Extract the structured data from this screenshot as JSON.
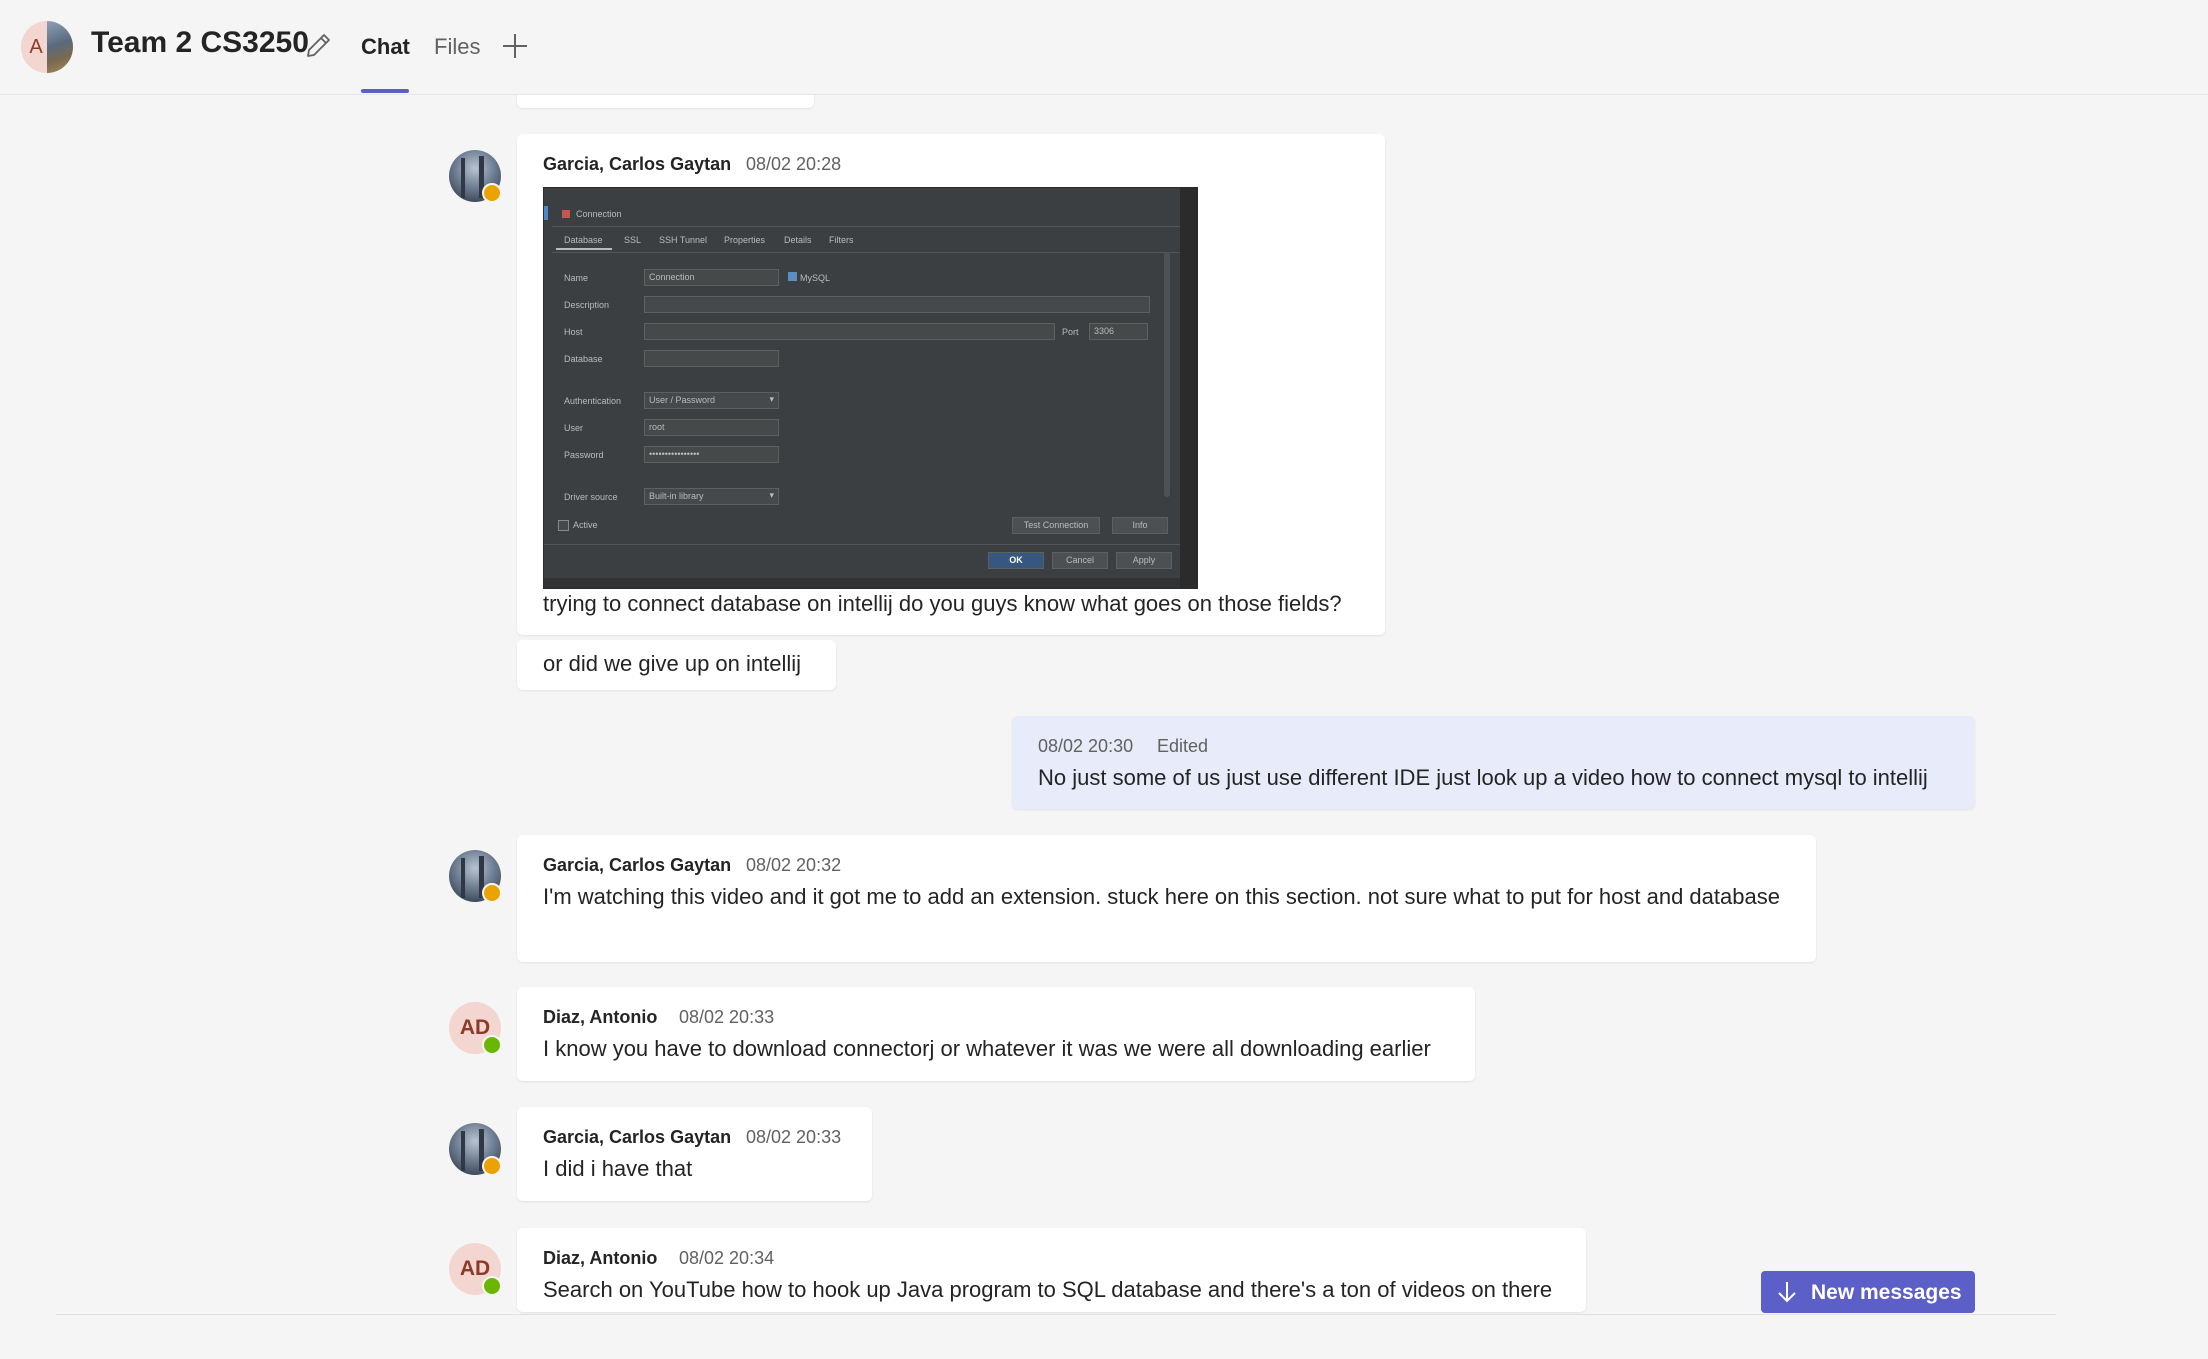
{
  "header": {
    "avatar_letter": "A",
    "title": "Team 2 CS3250",
    "tabs": [
      {
        "label": "Chat",
        "active": true
      },
      {
        "label": "Files",
        "active": false
      }
    ]
  },
  "messages": [
    {
      "sender": "Garcia, Carlos Gaytan",
      "time": "08/02 20:28",
      "status": "away",
      "text": "trying to connect database on intellij do you guys know what goes on those fields?",
      "followup": "or did we give up on intellij"
    },
    {
      "self": true,
      "time": "08/02 20:30",
      "edited": "Edited",
      "text": "No just some of us just use different IDE just look up a video how to connect mysql to intellij"
    },
    {
      "sender": "Garcia, Carlos Gaytan",
      "time": "08/02 20:32",
      "status": "away",
      "text": "I'm watching this video and it got me to add an extension. stuck here on this section. not sure what to put for host and database"
    },
    {
      "sender": "Diaz, Antonio",
      "initials": "AD",
      "time": "08/02 20:33",
      "status": "available",
      "text": "I know you have to download connectorj or whatever it was we were all downloading earlier"
    },
    {
      "sender": "Garcia, Carlos Gaytan",
      "time": "08/02 20:33",
      "status": "away",
      "text": "I did i have that"
    },
    {
      "sender": "Diaz, Antonio",
      "initials": "AD",
      "time": "08/02 20:34",
      "status": "available",
      "text": "Search on YouTube how to hook up Java program to SQL database and there's a ton of videos on there"
    }
  ],
  "screenshot": {
    "window_title": "Connection",
    "tabs": [
      "Database",
      "SSL",
      "SSH Tunnel",
      "Properties",
      "Details",
      "Filters"
    ],
    "name_label": "Name",
    "name_value": "Connection",
    "driver": "MySQL",
    "description_label": "Description",
    "host_label": "Host",
    "port_label": "Port",
    "port_value": "3306",
    "database_label": "Database",
    "auth_label": "Authentication",
    "auth_value": "User / Password",
    "user_label": "User",
    "user_value": "root",
    "password_label": "Password",
    "password_value": "••••••••••••••••",
    "driver_source_label": "Driver source",
    "driver_source_value": "Built-in library",
    "active_label": "Active",
    "test_connection": "Test Connection",
    "info": "Info",
    "ok": "OK",
    "cancel": "Cancel",
    "apply": "Apply"
  },
  "new_messages_button": "New messages",
  "colors": {
    "accent": "#5b5fc7",
    "self_bubble": "#e8ebfa",
    "away": "#eaa300",
    "available": "#6bb700"
  }
}
